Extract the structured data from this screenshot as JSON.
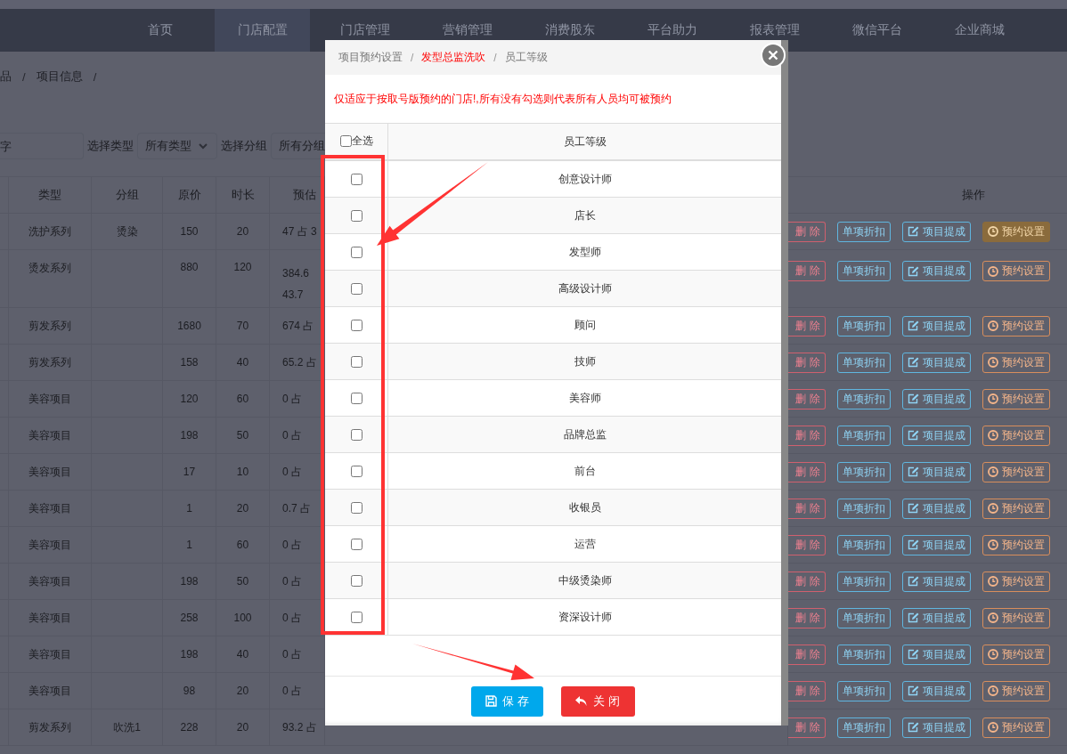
{
  "nav": {
    "items": [
      {
        "label": "首页",
        "selected": false
      },
      {
        "label": "门店配置",
        "selected": true
      },
      {
        "label": "门店管理",
        "selected": false
      },
      {
        "label": "营销管理",
        "selected": false
      },
      {
        "label": "消费股东",
        "selected": false
      },
      {
        "label": "平台助力",
        "selected": false
      },
      {
        "label": "报表管理",
        "selected": false
      },
      {
        "label": "微信平台",
        "selected": false
      },
      {
        "label": "企业商城",
        "selected": false
      }
    ]
  },
  "breadcrumb": [
    {
      "kind": "link",
      "label": "品"
    },
    {
      "kind": "separator",
      "label": "/"
    },
    {
      "kind": "link",
      "label": "项目信息"
    },
    {
      "kind": "separator",
      "label": "/"
    }
  ],
  "filters": {
    "search": {
      "placeholder": "字"
    },
    "type_label": "选择类型",
    "type_select": "所有类型",
    "group_label": "选择分组",
    "group_select": "所有分组"
  },
  "table": {
    "columns": [
      "类型",
      "分组",
      "原价",
      "时长",
      "预估",
      "操作"
    ],
    "rows": [
      {
        "type": "洗护系列",
        "group": "烫染",
        "price": "150",
        "duration": "20",
        "estimate": [
          "47 占 3"
        ],
        "actions": [
          {
            "kind": "delete",
            "label": "删除"
          },
          {
            "kind": "discount",
            "label": "单项折扣"
          },
          {
            "kind": "commission",
            "label": "项目提成"
          },
          {
            "kind": "booking",
            "label": "预约设置",
            "highlighted": true
          }
        ]
      },
      {
        "type": "烫发系列",
        "price": "880",
        "duration": "120",
        "estimate": [
          "384.6",
          "43.7"
        ],
        "actions": [
          {
            "kind": "delete",
            "label": "删除"
          },
          {
            "kind": "discount",
            "label": "单项折扣"
          },
          {
            "kind": "commission",
            "label": "项目提成"
          },
          {
            "kind": "booking",
            "label": "预约设置",
            "highlighted": false
          }
        ]
      },
      {
        "type": "剪发系列",
        "price": "1680",
        "duration": "70",
        "estimate": [
          "674 占"
        ],
        "actions": [
          {
            "kind": "delete",
            "label": "删除"
          },
          {
            "kind": "discount",
            "label": "单项折扣"
          },
          {
            "kind": "commission",
            "label": "项目提成"
          },
          {
            "kind": "booking",
            "label": "预约设置",
            "highlighted": false
          }
        ]
      },
      {
        "type": "剪发系列",
        "price": "158",
        "duration": "40",
        "estimate": [
          "65.2 占"
        ],
        "actions": [
          {
            "kind": "delete",
            "label": "删除"
          },
          {
            "kind": "discount",
            "label": "单项折扣"
          },
          {
            "kind": "commission",
            "label": "项目提成"
          },
          {
            "kind": "booking",
            "label": "预约设置",
            "highlighted": false
          }
        ]
      },
      {
        "type": "美容项目",
        "price": "120",
        "duration": "60",
        "estimate": [
          "0 占"
        ],
        "actions": [
          {
            "kind": "delete",
            "label": "删除"
          },
          {
            "kind": "discount",
            "label": "单项折扣"
          },
          {
            "kind": "commission",
            "label": "项目提成"
          },
          {
            "kind": "booking",
            "label": "预约设置",
            "highlighted": false
          }
        ]
      },
      {
        "type": "美容项目",
        "price": "198",
        "duration": "50",
        "estimate": [
          "0 占"
        ],
        "actions": [
          {
            "kind": "delete",
            "label": "删除"
          },
          {
            "kind": "discount",
            "label": "单项折扣"
          },
          {
            "kind": "commission",
            "label": "项目提成"
          },
          {
            "kind": "booking",
            "label": "预约设置",
            "highlighted": false
          }
        ]
      },
      {
        "type": "美容项目",
        "price": "17",
        "duration": "10",
        "estimate": [
          "0 占"
        ],
        "actions": [
          {
            "kind": "delete",
            "label": "删除"
          },
          {
            "kind": "discount",
            "label": "单项折扣"
          },
          {
            "kind": "commission",
            "label": "项目提成"
          },
          {
            "kind": "booking",
            "label": "预约设置",
            "highlighted": false
          }
        ]
      },
      {
        "type": "美容项目",
        "price": "1",
        "duration": "20",
        "estimate": [
          "0.7 占"
        ],
        "actions": [
          {
            "kind": "delete",
            "label": "删除"
          },
          {
            "kind": "discount",
            "label": "单项折扣"
          },
          {
            "kind": "commission",
            "label": "项目提成"
          },
          {
            "kind": "booking",
            "label": "预约设置",
            "highlighted": false
          }
        ]
      },
      {
        "type": "美容项目",
        "price": "1",
        "duration": "60",
        "estimate": [
          "0 占"
        ],
        "actions": [
          {
            "kind": "delete",
            "label": "删除"
          },
          {
            "kind": "discount",
            "label": "单项折扣"
          },
          {
            "kind": "commission",
            "label": "项目提成"
          },
          {
            "kind": "booking",
            "label": "预约设置",
            "highlighted": false
          }
        ]
      },
      {
        "type": "美容项目",
        "price": "198",
        "duration": "50",
        "estimate": [
          "0 占"
        ],
        "actions": [
          {
            "kind": "delete",
            "label": "删除"
          },
          {
            "kind": "discount",
            "label": "单项折扣"
          },
          {
            "kind": "commission",
            "label": "项目提成"
          },
          {
            "kind": "booking",
            "label": "预约设置",
            "highlighted": false
          }
        ]
      },
      {
        "type": "美容项目",
        "price": "258",
        "duration": "100",
        "estimate": [
          "0 占"
        ],
        "actions": [
          {
            "kind": "delete",
            "label": "删除"
          },
          {
            "kind": "discount",
            "label": "单项折扣"
          },
          {
            "kind": "commission",
            "label": "项目提成"
          },
          {
            "kind": "booking",
            "label": "预约设置",
            "highlighted": false
          }
        ]
      },
      {
        "type": "美容项目",
        "price": "198",
        "duration": "40",
        "estimate": [
          "0 占"
        ],
        "actions": [
          {
            "kind": "delete",
            "label": "删除"
          },
          {
            "kind": "discount",
            "label": "单项折扣"
          },
          {
            "kind": "commission",
            "label": "项目提成"
          },
          {
            "kind": "booking",
            "label": "预约设置",
            "highlighted": false
          }
        ]
      },
      {
        "type": "美容项目",
        "price": "98",
        "duration": "20",
        "estimate": [
          "0 占"
        ],
        "actions": [
          {
            "kind": "delete",
            "label": "删除"
          },
          {
            "kind": "discount",
            "label": "单项折扣"
          },
          {
            "kind": "commission",
            "label": "项目提成"
          },
          {
            "kind": "booking",
            "label": "预约设置",
            "highlighted": false
          }
        ]
      },
      {
        "type": "剪发系列",
        "group": "吹洗1",
        "price": "228",
        "duration": "20",
        "estimate": [
          "93.2 占"
        ],
        "actions": [
          {
            "kind": "delete",
            "label": "删除"
          },
          {
            "kind": "discount",
            "label": "单项折扣"
          },
          {
            "kind": "commission",
            "label": "项目提成"
          },
          {
            "kind": "booking",
            "label": "预约设置",
            "highlighted": false
          }
        ]
      }
    ]
  },
  "modal": {
    "breadcrumb": [
      {
        "kind": "link",
        "label": "项目预约设置",
        "active": false
      },
      {
        "kind": "separator",
        "label": "/"
      },
      {
        "kind": "link",
        "label": "发型总监洗吹",
        "active": true
      },
      {
        "kind": "separator",
        "label": "/"
      },
      {
        "kind": "link",
        "label": "员工等级",
        "active": false
      }
    ],
    "notice": "仅适应于按取号版预约的门店!,所有没有勾选则代表所有人员均可被预约",
    "select_all": {
      "label": "全选",
      "checked": false
    },
    "column_header": "员工等级",
    "levels": [
      {
        "name": "创意设计师",
        "checked": false
      },
      {
        "name": "店长",
        "checked": false
      },
      {
        "name": "发型师",
        "checked": false
      },
      {
        "name": "高级设计师",
        "checked": false
      },
      {
        "name": "顾问",
        "checked": false
      },
      {
        "name": "技师",
        "checked": false
      },
      {
        "name": "美容师",
        "checked": false
      },
      {
        "name": "品牌总监",
        "checked": false
      },
      {
        "name": "前台",
        "checked": false
      },
      {
        "name": "收银员",
        "checked": false
      },
      {
        "name": "运营",
        "checked": false
      },
      {
        "name": "中级烫染师",
        "checked": false
      },
      {
        "name": "资深设计师",
        "checked": false
      }
    ],
    "buttons": [
      {
        "kind": "save",
        "label": "保存"
      },
      {
        "kind": "close",
        "label": "关闭"
      }
    ]
  }
}
